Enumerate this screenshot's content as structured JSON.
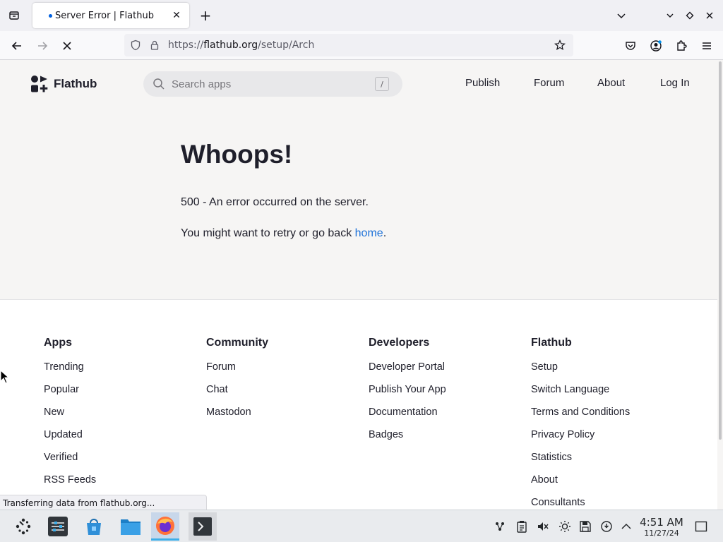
{
  "browser": {
    "tab": {
      "title": "Server Error | Flathub",
      "close_glyph": "✕"
    },
    "new_tab_glyph": "+",
    "url": {
      "prefix": "https://",
      "host": "flathub.org",
      "path": "/setup/Arch"
    },
    "status_text": "Transferring data from flathub.org..."
  },
  "site": {
    "logo_text": "Flathub",
    "search": {
      "placeholder": "Search apps",
      "shortcut": "/"
    },
    "nav": {
      "publish": "Publish",
      "forum": "Forum",
      "about": "About",
      "login": "Log In"
    }
  },
  "error": {
    "title": "Whoops!",
    "message": "500 - An error occurred on the server.",
    "retry_prefix": "You might want to retry or go back ",
    "retry_link": "home",
    "retry_suffix": "."
  },
  "footer": {
    "columns": [
      {
        "heading": "Apps",
        "links": [
          "Trending",
          "Popular",
          "New",
          "Updated",
          "Verified",
          "RSS Feeds"
        ]
      },
      {
        "heading": "Community",
        "links": [
          "Forum",
          "Chat",
          "Mastodon"
        ]
      },
      {
        "heading": "Developers",
        "links": [
          "Developer Portal",
          "Publish Your App",
          "Documentation",
          "Badges"
        ]
      },
      {
        "heading": "Flathub",
        "links": [
          "Setup",
          "Switch Language",
          "Terms and Conditions",
          "Privacy Policy",
          "Statistics",
          "About",
          "Consultants"
        ]
      }
    ]
  },
  "taskbar": {
    "clock_time": "4:51 AM",
    "clock_date": "11/27/24",
    "apps": [
      "app-launcher-icon",
      "system-settings-icon",
      "discover-store-icon",
      "dolphin-files-icon",
      "firefox-icon",
      "konsole-terminal-icon"
    ],
    "tray": [
      "network-icon",
      "clipboard-icon",
      "audio-muted-icon",
      "brightness-icon",
      "save-icon",
      "updates-icon",
      "tray-expand-icon"
    ]
  },
  "colors": {
    "accent": "#1c71d8",
    "page_bg": "#f6f5f4",
    "text": "#1f1f2b"
  }
}
